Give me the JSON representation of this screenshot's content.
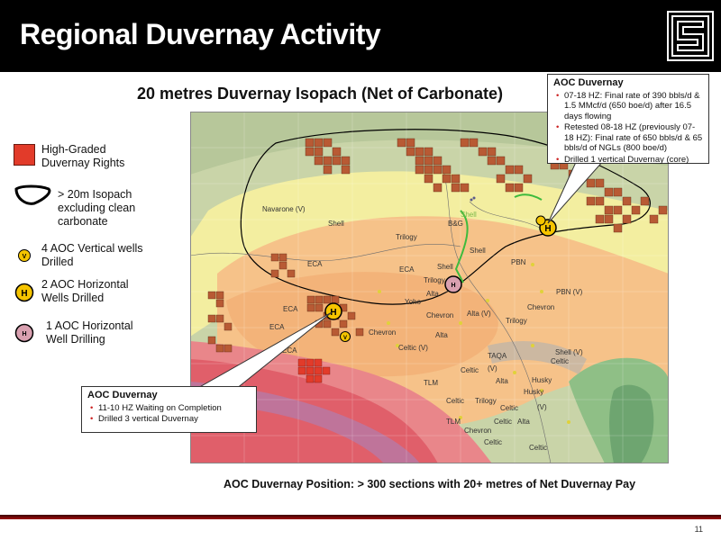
{
  "title": "Regional Duvernay Activity",
  "map_title": "20 metres Duvernay Isopach (Net of Carbonate)",
  "legend": {
    "rights": "High-Graded Duvernay Rights",
    "isopach": "> 20m Isopach excluding clean carbonate",
    "vertical": "4 AOC Vertical wells Drilled",
    "horizontal": "2 AOC Horizontal Wells Drilled",
    "drilling": "1 AOC Horizontal Well Drilling"
  },
  "well_symbols": {
    "vertical": "V",
    "horizontal": "H"
  },
  "callout_ne": {
    "title": "AOC Duvernay",
    "items": [
      "07-18 HZ: Final rate of 390 bbls/d & 1.5 MMcf/d (650 boe/d) after 16.5 days flowing",
      "Retested 08-18 HZ (previously 07-18 HZ): Final rate of 650 bbls/d & 65 bbls/d of NGLs (800 boe/d)",
      "Drilled 1 vertical Duvernay (core)"
    ]
  },
  "callout_sw": {
    "title": "AOC Duvernay",
    "items": [
      "11-10 HZ Waiting on Completion",
      "Drilled 3 vertical Duvernay"
    ]
  },
  "map_labels": {
    "navarone": "Navarone (V)",
    "shell_nw": "Shell",
    "shell_center": "Shell",
    "bg": "B&G",
    "trilogy_n": "Trilogy",
    "shell_mid": "Shell",
    "shell_mid2": "Shell",
    "eca_n": "ECA",
    "eca_mid": "ECA",
    "trilogy_mid": "Trilogy",
    "pbn": "PBN",
    "pbn_v": "PBN (V)",
    "alta_1": "Alta",
    "yoho": "Yoho",
    "eca_w1": "ECA",
    "eca_w2": "ECA",
    "eca_w3": "ECA",
    "chevron_1": "Chevron",
    "alta_v": "Alta (V)",
    "chevron_2": "Chevron",
    "trilogy_e": "Trilogy",
    "chevron_3": "Chevron",
    "alta_2": "Alta",
    "celtic_v": "Celtic (V)",
    "taqa": "TAQA",
    "taqa_v": "(V)",
    "shell_v": "Shell (V)",
    "celtic_e": "Celtic",
    "celtic_1": "Celtic",
    "husky_1": "Husky",
    "tlm_1": "TLM",
    "alta_3": "Alta",
    "husky_v": "Husky",
    "husky_v2": "(V)",
    "celtic_2": "Celtic",
    "trilogy_s": "Trilogy",
    "celtic_3": "Celtic",
    "tlm_2": "TLM",
    "alta_4": "Alta",
    "celtic_4": "Celtic",
    "chevron_4": "Chevron",
    "celtic_5": "Celtic",
    "celtic_6": "Celtic"
  },
  "caption": "AOC Duvernay Position: > 300 sections with 20+ metres of Net Duvernay Pay",
  "page_number": "11",
  "colors": {
    "header_bg": "#000000",
    "rights": "#c0502a",
    "isopach_outline": "#000000",
    "well_fill": "#f5c400",
    "drilling_fill": "#d9a0b0",
    "callout_bullet": "#cc2222"
  }
}
